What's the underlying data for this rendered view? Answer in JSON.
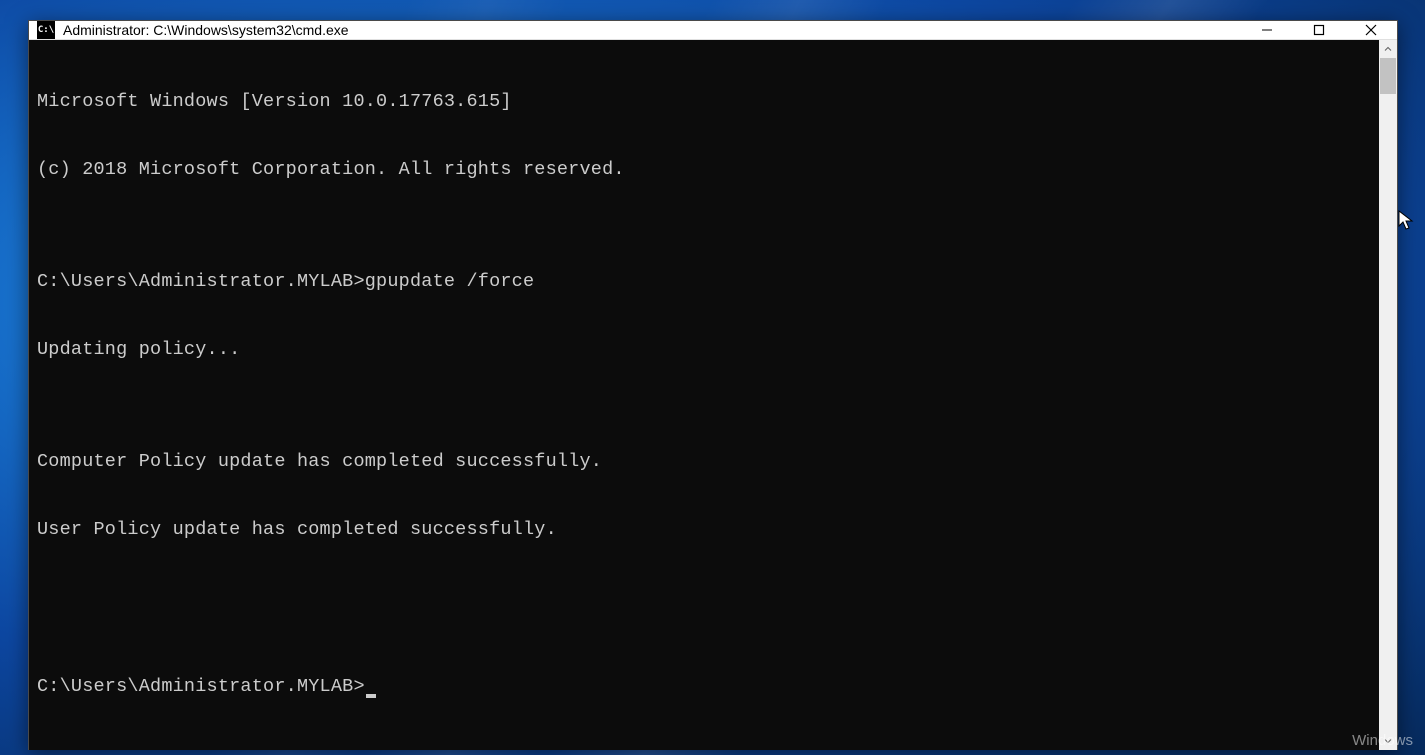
{
  "window": {
    "title": "Administrator: C:\\Windows\\system32\\cmd.exe",
    "icon_label": "C:\\"
  },
  "terminal": {
    "lines": [
      "Microsoft Windows [Version 10.0.17763.615]",
      "(c) 2018 Microsoft Corporation. All rights reserved.",
      "",
      "C:\\Users\\Administrator.MYLAB>gpupdate /force",
      "Updating policy...",
      "",
      "Computer Policy update has completed successfully.",
      "User Policy update has completed successfully.",
      "",
      ""
    ],
    "prompt": "C:\\Users\\Administrator.MYLAB>"
  },
  "desktop": {
    "watermark": "Windows"
  }
}
